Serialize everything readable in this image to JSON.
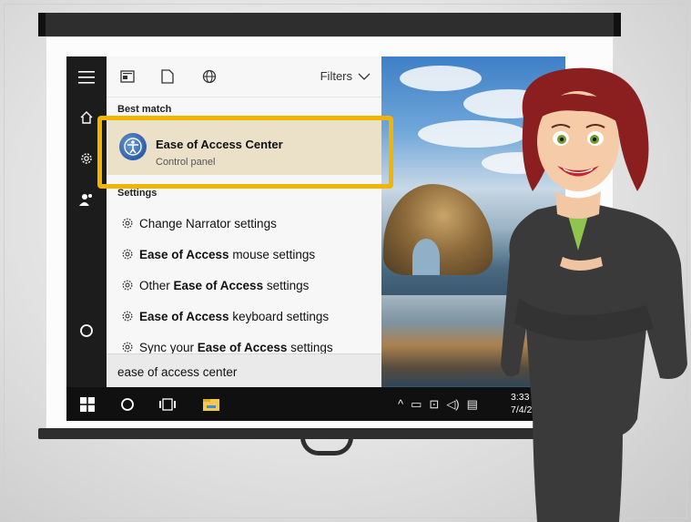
{
  "start_menu": {
    "filters_label": "Filters",
    "best_match_label": "Best match",
    "best_match": {
      "title": "Ease of Access Center",
      "subtitle": "Control panel"
    },
    "settings_label": "Settings",
    "settings_items": [
      {
        "pre": "Change Narrator settings",
        "bold": "",
        "post": ""
      },
      {
        "pre": "",
        "bold": "Ease of Access",
        "post": " mouse settings"
      },
      {
        "pre": "Other ",
        "bold": "Ease of Access",
        "post": " settings"
      },
      {
        "pre": "",
        "bold": "Ease of Access",
        "post": " keyboard settings"
      },
      {
        "pre": "Sync your ",
        "bold": "Ease of Access",
        "post": " settings"
      }
    ]
  },
  "search": {
    "value": "ease of access center"
  },
  "taskbar": {
    "time": "3:33 P",
    "date": "7/4/2"
  },
  "colors": {
    "highlight": "#f3b400",
    "best_match_bg": "#ebe0c8",
    "taskbar": "#101010"
  },
  "icons": [
    "menu-icon",
    "home-icon",
    "gear-icon",
    "user-icon",
    "circle-icon",
    "windows-icon",
    "cortana-icon",
    "task-view-icon",
    "file-explorer-icon",
    "news-icon",
    "document-icon",
    "globe-icon",
    "chevron-down-icon"
  ]
}
